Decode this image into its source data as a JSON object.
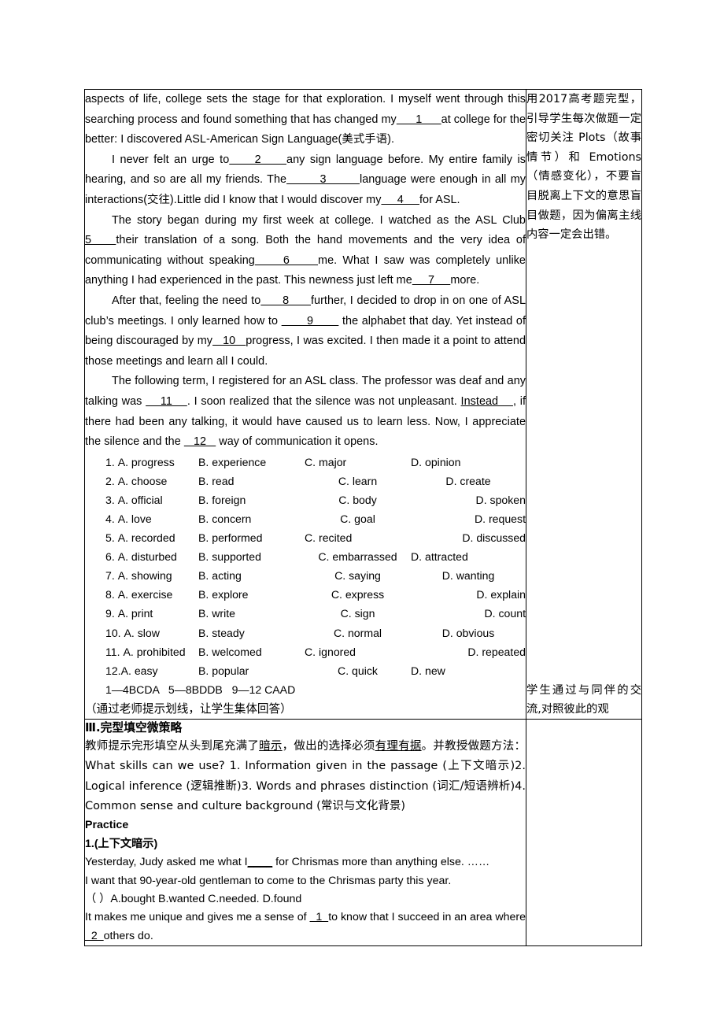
{
  "document": {
    "passage": {
      "paragraphs": [
        {
          "indent": false,
          "segments": [
            {
              "t": "text",
              "v": "aspects of life, college sets the stage for that exploration. I myself went through this searching process and found something that has changed my"
            },
            {
              "t": "blank",
              "v": "      1      "
            },
            {
              "t": "text",
              "v": "at college for the better: I discovered ASL-American Sign Language(美式手语)."
            }
          ]
        },
        {
          "indent": true,
          "segments": [
            {
              "t": "text",
              "v": "I never felt an urge to"
            },
            {
              "t": "blank",
              "v": "     2     "
            },
            {
              "t": "text",
              "v": "any sign language before. My entire family is hearing, and so are all my friends. The"
            },
            {
              "t": "blank",
              "v": "        3        "
            },
            {
              "t": "text",
              "v": "language were enough in all my interactions(交往).Little did I know that I would discover my"
            },
            {
              "t": "blank",
              "v": "     4     "
            },
            {
              "t": "text",
              "v": "for ASL."
            }
          ]
        },
        {
          "indent": true,
          "segments": [
            {
              "t": "text",
              "v": "The story began during my first week at college. I watched as the ASL Club "
            },
            {
              "t": "blank",
              "v": "5    "
            },
            {
              "t": "text",
              "v": "their translation of a song. Both the hand movements and the very idea of communicating without speaking"
            },
            {
              "t": "blank",
              "v": "     6     "
            },
            {
              "t": "text",
              "v": "me. What I saw was completely unlike anything I had experienced in the past. This newness just left me"
            },
            {
              "t": "blank",
              "v": "     7     "
            },
            {
              "t": "text",
              "v": "more."
            }
          ]
        },
        {
          "indent": true,
          "segments": [
            {
              "t": "text",
              "v": "After that, feeling the need to"
            },
            {
              "t": "blank",
              "v": "      8      "
            },
            {
              "t": "text",
              "v": "further, I decided to drop in on one of ASL club’s meetings. I only learned how to "
            },
            {
              "t": "blank",
              "v": "       9       "
            },
            {
              "t": "text",
              "v": " the alphabet that day. Yet instead of being discouraged by my"
            },
            {
              "t": "blank",
              "v": "   10   "
            },
            {
              "t": "text",
              "v": "progress, I was excited. I then made it a point to attend those meetings and learn all I could."
            }
          ]
        },
        {
          "indent": true,
          "segments": [
            {
              "t": "text",
              "v": "The following term, I registered for an ASL class. The professor was deaf and any talking was "
            },
            {
              "t": "blank",
              "v": "    11    "
            },
            {
              "t": "text",
              "v": ". I soon realized that the silence was not unpleasant. "
            },
            {
              "t": "blank",
              "v": "Instead    "
            },
            {
              "t": "text",
              "v": ", if there had been any talking, it would have caused us to learn less. Now, I appreciate the silence and the "
            },
            {
              "t": "blank",
              "v": "   12   "
            },
            {
              "t": "text",
              "v": " way of communication it opens."
            }
          ]
        }
      ],
      "options": [
        {
          "n": "1.",
          "a": "A. progress",
          "b": "B. experience",
          "c": "C. major",
          "d": "D. opinion",
          "just": "j1"
        },
        {
          "n": "2.",
          "a": "A. choose",
          "b": "B. read",
          "c": "C. learn",
          "d": "D. create",
          "just": "j2"
        },
        {
          "n": "3.",
          "a": "A. official",
          "b": "B. foreign",
          "c": "C. body",
          "d": "D. spoken",
          "just": "j3"
        },
        {
          "n": "4.",
          "a": "A. love",
          "b": "B. concern",
          "c": "C. goal",
          "d": "D. request",
          "just": "j3"
        },
        {
          "n": "5.",
          "a": "A. recorded",
          "b": "B. performed",
          "c": "C. recited",
          "d": "D. discussed",
          "just": "j4"
        },
        {
          "n": "6.",
          "a": "A. disturbed",
          "b": "B. supported",
          "c": "C. embarrassed",
          "d": "D. attracted",
          "just": "j5"
        },
        {
          "n": "7.",
          "a": "A. showing",
          "b": "B. acting",
          "c": "C. saying",
          "d": "D. wanting",
          "just": "j2"
        },
        {
          "n": "8.",
          "a": "A. exercise",
          "b": "B. explore",
          "c": "C. express",
          "d": "D. explain",
          "just": "j3"
        },
        {
          "n": "9.",
          "a": "A. print",
          "b": "B. write",
          "c": "C. sign",
          "d": "D. count",
          "just": "j3"
        },
        {
          "n": "10.",
          "a": "A. slow",
          "b": "B. steady",
          "c": "C. normal",
          "d": "D. obvious",
          "just": "j2"
        },
        {
          "n": "11.",
          "a": "A. prohibited",
          "b": "B. welcomed",
          "c": "C. ignored",
          "d": "D. repeated",
          "just": "j4"
        },
        {
          "n": "12.",
          "a": "A. easy",
          "b": "B. popular",
          "c": "C. quick",
          "d": "D. new",
          "just": "j5"
        }
      ],
      "answer_key": "1—4BCDA   5—8BDDB   9—12 CAAD",
      "teacher_note": "（通过老师提示划线，让学生集体回答）"
    },
    "side_note_top": "用2017高考题完型，引导学生每次做题一定密切关注 Plots（故事情节）和 Emotions（情感变化），不要盲目脱离上下文的意思盲目做题，因为偏离主线内容一定会出错。",
    "side_note_bottom": "学生通过与同伴的交流,对照彼此的观",
    "section2": {
      "heading": "Ⅲ.完型填空微策略",
      "intro_pre": "教师提示完形填空从头到尾充满了",
      "intro_u1": "暗示",
      "intro_mid": "，做出的选择必须",
      "intro_u2": "有理有据",
      "intro_post": "。并教授做题方法：What skills can we use?    1. Information given in the passage (上下文暗示)2. Logical inference (逻辑推断)3. Words and phrases distinction (词汇/短语辨析)4. Common sense and culture background (常识与文化背景)",
      "practice_label": "Practice",
      "practice_sub": "1.(上下文暗示)",
      "q_line1_pre": "Yesterday, Judy asked me what I",
      "q_line1_blank": "____",
      "q_line1_post": " for Chrismas more than anything else. ……",
      "q_line2": "I want that 90-year-old gentleman to come to the Chrismas party this year.",
      "q_choices": "（    ）A.bought    B.wanted    C.needed.    D.found",
      "q_line3_pre": "It makes me unique and gives me a sense of ",
      "q_line3_blank": "  1  ",
      "q_line3_mid": "to know that I succeed in an area where ",
      "q_line3_blank2": "  2  ",
      "q_line3_post": "others do."
    }
  }
}
